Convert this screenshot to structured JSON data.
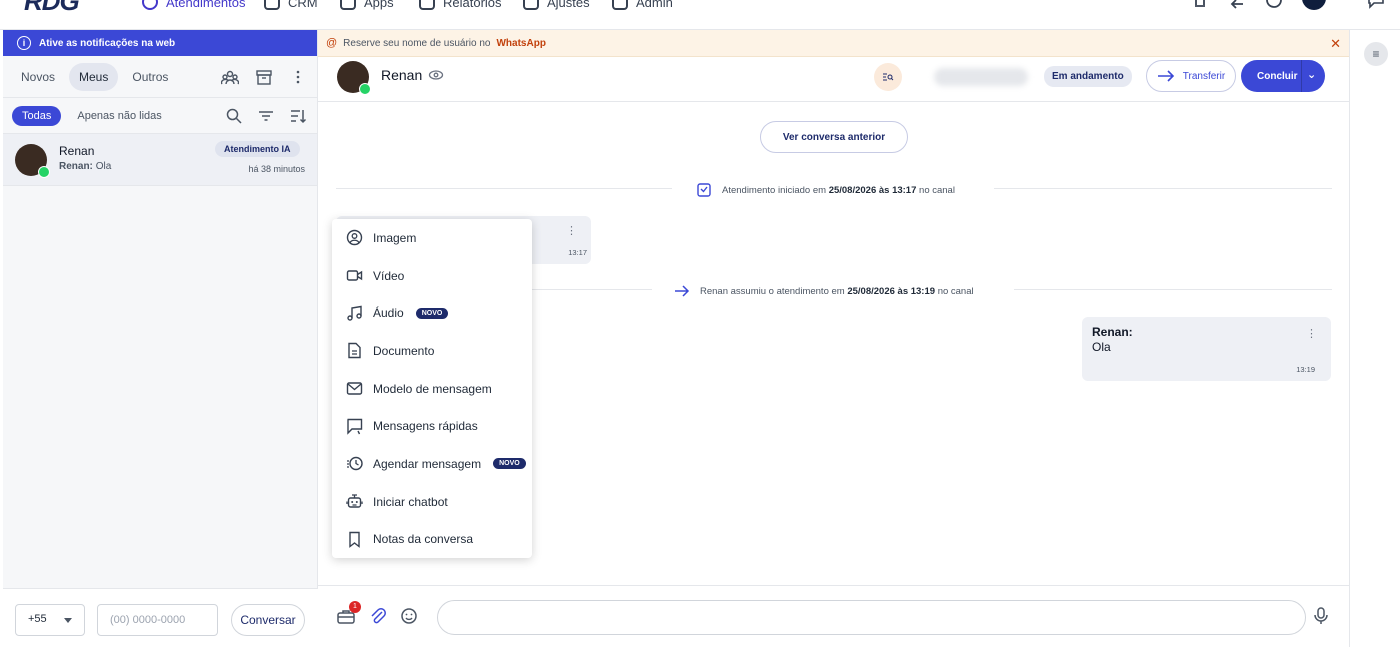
{
  "topnav": {
    "logo": "RDG",
    "items": [
      {
        "label": "Atendimentos",
        "active": true
      },
      {
        "label": "CRM"
      },
      {
        "label": "Apps"
      },
      {
        "label": "Relatórios"
      },
      {
        "label": "Ajustes"
      },
      {
        "label": "Admin"
      }
    ]
  },
  "left": {
    "notification": "Ative as notificações na web",
    "tabs": [
      "Novos",
      "Meus",
      "Outros"
    ],
    "active_tab": "Meus",
    "filters": {
      "all": "Todas",
      "unread": "Apenas não lidas"
    },
    "conversation": {
      "name": "Renan",
      "last_sender": "Renan:",
      "last_message": "Ola",
      "badge": "Atendimento IA",
      "time": "há 38 minutos"
    },
    "dial": {
      "country_code": "+55",
      "phone_placeholder": "(00) 0000-0000",
      "button": "Conversar"
    }
  },
  "main": {
    "banner": {
      "text": "Reserve seu nome de usuário no",
      "brand": "WhatsApp"
    },
    "header": {
      "name": "Renan",
      "status": "Em andamento",
      "transfer": "Transferir",
      "finish": "Concluir"
    },
    "prev_conversation": "Ver conversa anterior",
    "system1": {
      "text": "Atendimento iniciado em",
      "date": "25/08/2026 às 13:17",
      "suffix": "no canal"
    },
    "system2": {
      "text": "Renan assumiu o atendimento em",
      "date": "25/08/2026 às 13:19",
      "suffix": "no canal"
    },
    "msg_in": {
      "time": "13:17"
    },
    "msg_out": {
      "sender": "Renan:",
      "text": "Ola",
      "time": "13:19"
    },
    "menu": [
      {
        "label": "Imagem",
        "icon": "image-icon"
      },
      {
        "label": "Vídeo",
        "icon": "video-icon"
      },
      {
        "label": "Áudio",
        "icon": "music-icon",
        "badge": "NOVO"
      },
      {
        "label": "Documento",
        "icon": "document-icon"
      },
      {
        "label": "Modelo de mensagem",
        "icon": "mail-icon"
      },
      {
        "label": "Mensagens rápidas",
        "icon": "quick-message-icon"
      },
      {
        "label": "Agendar mensagem",
        "icon": "schedule-icon",
        "badge": "NOVO"
      },
      {
        "label": "Iniciar chatbot",
        "icon": "bot-icon"
      },
      {
        "label": "Notas da conversa",
        "icon": "bookmark-icon"
      }
    ],
    "composer": {
      "badge_count": "1"
    }
  },
  "colors": {
    "primary": "#3b48d6",
    "navy": "#1e2b6b",
    "banner_bg": "#fdf3e6",
    "whatsapp": "#25d366"
  }
}
